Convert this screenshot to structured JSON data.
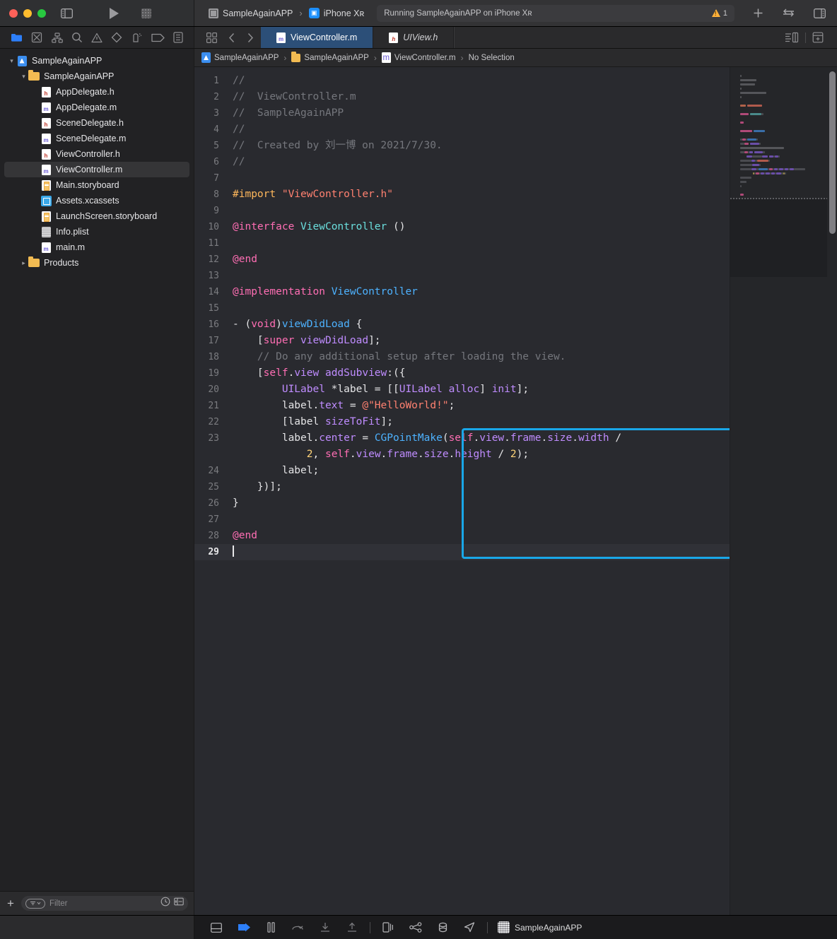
{
  "window": {
    "title": "SampleAgainAPP",
    "traffic_lights": [
      "close",
      "minimize",
      "zoom"
    ]
  },
  "toolbar": {
    "sidebar_toggle_icon": "sidebar-toggle-icon",
    "run_icon": "run-play-icon",
    "stop_icon": "stop-square-icon",
    "scheme_project": "SampleAgainAPP",
    "scheme_separator": "›",
    "scheme_device": "iPhone Xʀ",
    "status_text": "Running SampleAgainAPP on iPhone Xʀ",
    "warning_count": "1",
    "add_icon": "plus-icon",
    "swap_icon": "swap-arrows-icon",
    "inspector_icon": "inspector-toggle-icon"
  },
  "navigator_bar": {
    "icons": [
      {
        "name": "folder-icon",
        "active": true
      },
      {
        "name": "source-control-icon",
        "active": false
      },
      {
        "name": "symbol-hierarchy-icon",
        "active": false
      },
      {
        "name": "search-icon",
        "active": false
      },
      {
        "name": "issue-warning-icon",
        "active": false
      },
      {
        "name": "test-diamond-icon",
        "active": false
      },
      {
        "name": "debug-gauge-icon",
        "active": false
      },
      {
        "name": "breakpoint-tag-icon",
        "active": false
      },
      {
        "name": "report-list-icon",
        "active": false
      }
    ]
  },
  "tab_bar": {
    "grid_icon": "tab-grid-icon",
    "back_icon": "chevron-left-icon",
    "forward_icon": "chevron-right-icon",
    "tabs": [
      {
        "label": "ViewController.m",
        "type": "m",
        "active": true
      },
      {
        "label": "UIView.h",
        "type": "h",
        "active": false
      }
    ],
    "right_icons": [
      {
        "name": "editor-options-icon"
      },
      {
        "name": "add-editor-icon"
      }
    ]
  },
  "navigator": {
    "items": [
      {
        "label": "SampleAgainAPP",
        "icon": "xcode-project-icon",
        "indent": 0,
        "disclosure": "open",
        "selected": false
      },
      {
        "label": "SampleAgainAPP",
        "icon": "folder-icon",
        "indent": 1,
        "disclosure": "open",
        "selected": false
      },
      {
        "label": "AppDelegate.h",
        "icon": "header-file-icon",
        "indent": 2,
        "disclosure": "none",
        "selected": false
      },
      {
        "label": "AppDelegate.m",
        "icon": "objc-file-icon",
        "indent": 2,
        "disclosure": "none",
        "selected": false
      },
      {
        "label": "SceneDelegate.h",
        "icon": "header-file-icon",
        "indent": 2,
        "disclosure": "none",
        "selected": false
      },
      {
        "label": "SceneDelegate.m",
        "icon": "objc-file-icon",
        "indent": 2,
        "disclosure": "none",
        "selected": false
      },
      {
        "label": "ViewController.h",
        "icon": "header-file-icon",
        "indent": 2,
        "disclosure": "none",
        "selected": false
      },
      {
        "label": "ViewController.m",
        "icon": "objc-file-icon",
        "indent": 2,
        "disclosure": "none",
        "selected": true
      },
      {
        "label": "Main.storyboard",
        "icon": "storyboard-icon",
        "indent": 2,
        "disclosure": "none",
        "selected": false
      },
      {
        "label": "Assets.xcassets",
        "icon": "assets-catalog-icon",
        "indent": 2,
        "disclosure": "none",
        "selected": false
      },
      {
        "label": "LaunchScreen.storyboard",
        "icon": "storyboard-icon",
        "indent": 2,
        "disclosure": "none",
        "selected": false
      },
      {
        "label": "Info.plist",
        "icon": "plist-icon",
        "indent": 2,
        "disclosure": "none",
        "selected": false
      },
      {
        "label": "main.m",
        "icon": "objc-file-icon",
        "indent": 2,
        "disclosure": "none",
        "selected": false
      },
      {
        "label": "Products",
        "icon": "folder-icon",
        "indent": 1,
        "disclosure": "closed",
        "selected": false
      }
    ],
    "footer": {
      "add_label": "+",
      "filter_placeholder": "Filter",
      "recent_icon": "clock-icon",
      "filter_toggle_icon": "filter-toggle-icon",
      "source-control_icon": "sourcecontrol-filter-icon"
    }
  },
  "breadcrumb": {
    "items": [
      {
        "label": "SampleAgainAPP",
        "icon": "xcode-project-icon"
      },
      {
        "label": "SampleAgainAPP",
        "icon": "folder-icon"
      },
      {
        "label": "ViewController.m",
        "icon": "objc-file-icon"
      },
      {
        "label": "No Selection",
        "icon": "none"
      }
    ],
    "separator": "›"
  },
  "editor": {
    "filename": "ViewController.m",
    "highlight_color": "#19a7e8",
    "active_line": 29,
    "lines": [
      {
        "n": 1,
        "tokens": [
          {
            "t": "//",
            "c": "cm"
          }
        ]
      },
      {
        "n": 2,
        "tokens": [
          {
            "t": "//  ViewController.m",
            "c": "cm"
          }
        ]
      },
      {
        "n": 3,
        "tokens": [
          {
            "t": "//  SampleAgainAPP",
            "c": "cm"
          }
        ]
      },
      {
        "n": 4,
        "tokens": [
          {
            "t": "//",
            "c": "cm"
          }
        ]
      },
      {
        "n": 5,
        "tokens": [
          {
            "t": "//  Created by 刘一博 on 2021/7/30.",
            "c": "cm"
          }
        ]
      },
      {
        "n": 6,
        "tokens": [
          {
            "t": "//",
            "c": "cm"
          }
        ]
      },
      {
        "n": 7,
        "tokens": []
      },
      {
        "n": 8,
        "tokens": [
          {
            "t": "#import",
            "c": "pre"
          },
          {
            "t": " ",
            "c": "pln"
          },
          {
            "t": "\"ViewController.h\"",
            "c": "str"
          }
        ]
      },
      {
        "n": 9,
        "tokens": []
      },
      {
        "n": 10,
        "tokens": [
          {
            "t": "@interface",
            "c": "kw"
          },
          {
            "t": " ",
            "c": "pln"
          },
          {
            "t": "ViewController",
            "c": "typ"
          },
          {
            "t": " ()",
            "c": "pln"
          }
        ]
      },
      {
        "n": 11,
        "tokens": []
      },
      {
        "n": 12,
        "tokens": [
          {
            "t": "@end",
            "c": "kw"
          }
        ]
      },
      {
        "n": 13,
        "tokens": []
      },
      {
        "n": 14,
        "tokens": [
          {
            "t": "@implementation",
            "c": "kw"
          },
          {
            "t": " ",
            "c": "pln"
          },
          {
            "t": "ViewController",
            "c": "cls"
          }
        ]
      },
      {
        "n": 15,
        "tokens": []
      },
      {
        "n": 16,
        "tokens": [
          {
            "t": "- (",
            "c": "pln"
          },
          {
            "t": "void",
            "c": "kw"
          },
          {
            "t": ")",
            "c": "pln"
          },
          {
            "t": "viewDidLoad",
            "c": "cls"
          },
          {
            "t": " {",
            "c": "pln"
          }
        ]
      },
      {
        "n": 17,
        "tokens": [
          {
            "t": "    [",
            "c": "pln"
          },
          {
            "t": "super",
            "c": "kw"
          },
          {
            "t": " ",
            "c": "pln"
          },
          {
            "t": "viewDidLoad",
            "c": "mth"
          },
          {
            "t": "];",
            "c": "pln"
          }
        ]
      },
      {
        "n": 18,
        "tokens": [
          {
            "t": "    // Do any additional setup after loading the view.",
            "c": "cm"
          }
        ]
      },
      {
        "n": 19,
        "tokens": [
          {
            "t": "    [",
            "c": "pln"
          },
          {
            "t": "self",
            "c": "kw"
          },
          {
            "t": ".",
            "c": "pln"
          },
          {
            "t": "view",
            "c": "mth"
          },
          {
            "t": " ",
            "c": "pln"
          },
          {
            "t": "addSubview",
            "c": "mth"
          },
          {
            "t": ":({",
            "c": "pln"
          }
        ]
      },
      {
        "n": 20,
        "tokens": [
          {
            "t": "        ",
            "c": "pln"
          },
          {
            "t": "UILabel",
            "c": "mth"
          },
          {
            "t": " *label = [[",
            "c": "pln"
          },
          {
            "t": "UILabel",
            "c": "mth"
          },
          {
            "t": " ",
            "c": "pln"
          },
          {
            "t": "alloc",
            "c": "mth"
          },
          {
            "t": "] ",
            "c": "pln"
          },
          {
            "t": "init",
            "c": "mth"
          },
          {
            "t": "];",
            "c": "pln"
          }
        ]
      },
      {
        "n": 21,
        "tokens": [
          {
            "t": "        label.",
            "c": "pln"
          },
          {
            "t": "text",
            "c": "mth"
          },
          {
            "t": " = ",
            "c": "pln"
          },
          {
            "t": "@\"HelloWorld!\"",
            "c": "str"
          },
          {
            "t": ";",
            "c": "pln"
          }
        ]
      },
      {
        "n": 22,
        "tokens": [
          {
            "t": "        [label ",
            "c": "pln"
          },
          {
            "t": "sizeToFit",
            "c": "mth"
          },
          {
            "t": "];",
            "c": "pln"
          }
        ]
      },
      {
        "n": 23,
        "tokens": [
          {
            "t": "        label.",
            "c": "pln"
          },
          {
            "t": "center",
            "c": "mth"
          },
          {
            "t": " = ",
            "c": "pln"
          },
          {
            "t": "CGPointMake",
            "c": "cls"
          },
          {
            "t": "(",
            "c": "pln"
          },
          {
            "t": "self",
            "c": "kw"
          },
          {
            "t": ".",
            "c": "pln"
          },
          {
            "t": "view",
            "c": "mth"
          },
          {
            "t": ".",
            "c": "pln"
          },
          {
            "t": "frame",
            "c": "mth"
          },
          {
            "t": ".",
            "c": "pln"
          },
          {
            "t": "size",
            "c": "mth"
          },
          {
            "t": ".",
            "c": "pln"
          },
          {
            "t": "width",
            "c": "mth"
          },
          {
            "t": " /\n            ",
            "c": "pln"
          },
          {
            "t": "2",
            "c": "num"
          },
          {
            "t": ", ",
            "c": "pln"
          },
          {
            "t": "self",
            "c": "kw"
          },
          {
            "t": ".",
            "c": "pln"
          },
          {
            "t": "view",
            "c": "mth"
          },
          {
            "t": ".",
            "c": "pln"
          },
          {
            "t": "frame",
            "c": "mth"
          },
          {
            "t": ".",
            "c": "pln"
          },
          {
            "t": "size",
            "c": "mth"
          },
          {
            "t": ".",
            "c": "pln"
          },
          {
            "t": "height",
            "c": "mth"
          },
          {
            "t": " / ",
            "c": "pln"
          },
          {
            "t": "2",
            "c": "num"
          },
          {
            "t": ");",
            "c": "pln"
          }
        ],
        "wrapped": true
      },
      {
        "n": 24,
        "tokens": [
          {
            "t": "        label;",
            "c": "pln"
          }
        ]
      },
      {
        "n": 25,
        "tokens": [
          {
            "t": "    })];",
            "c": "pln"
          }
        ]
      },
      {
        "n": 26,
        "tokens": [
          {
            "t": "}",
            "c": "pln"
          }
        ]
      },
      {
        "n": 27,
        "tokens": []
      },
      {
        "n": 28,
        "tokens": [
          {
            "t": "@end",
            "c": "kw"
          }
        ]
      },
      {
        "n": 29,
        "tokens": [],
        "active": true,
        "caret": true
      }
    ]
  },
  "bottom_bar": {
    "icons": [
      {
        "name": "show-debug-area-icon",
        "active": false
      },
      {
        "name": "step-continue-icon",
        "active": true
      },
      {
        "name": "pause-icon",
        "active": false
      },
      {
        "name": "step-over-icon",
        "active": false
      },
      {
        "name": "step-into-icon",
        "active": false
      },
      {
        "name": "step-out-icon",
        "active": false
      },
      {
        "name": "view-hierarchy-icon",
        "active": false
      },
      {
        "name": "memory-graph-icon",
        "active": false
      },
      {
        "name": "simulate-location-icon",
        "active": false
      },
      {
        "name": "location-arrow-icon",
        "active": false
      }
    ],
    "target_label": "SampleAgainAPP"
  }
}
